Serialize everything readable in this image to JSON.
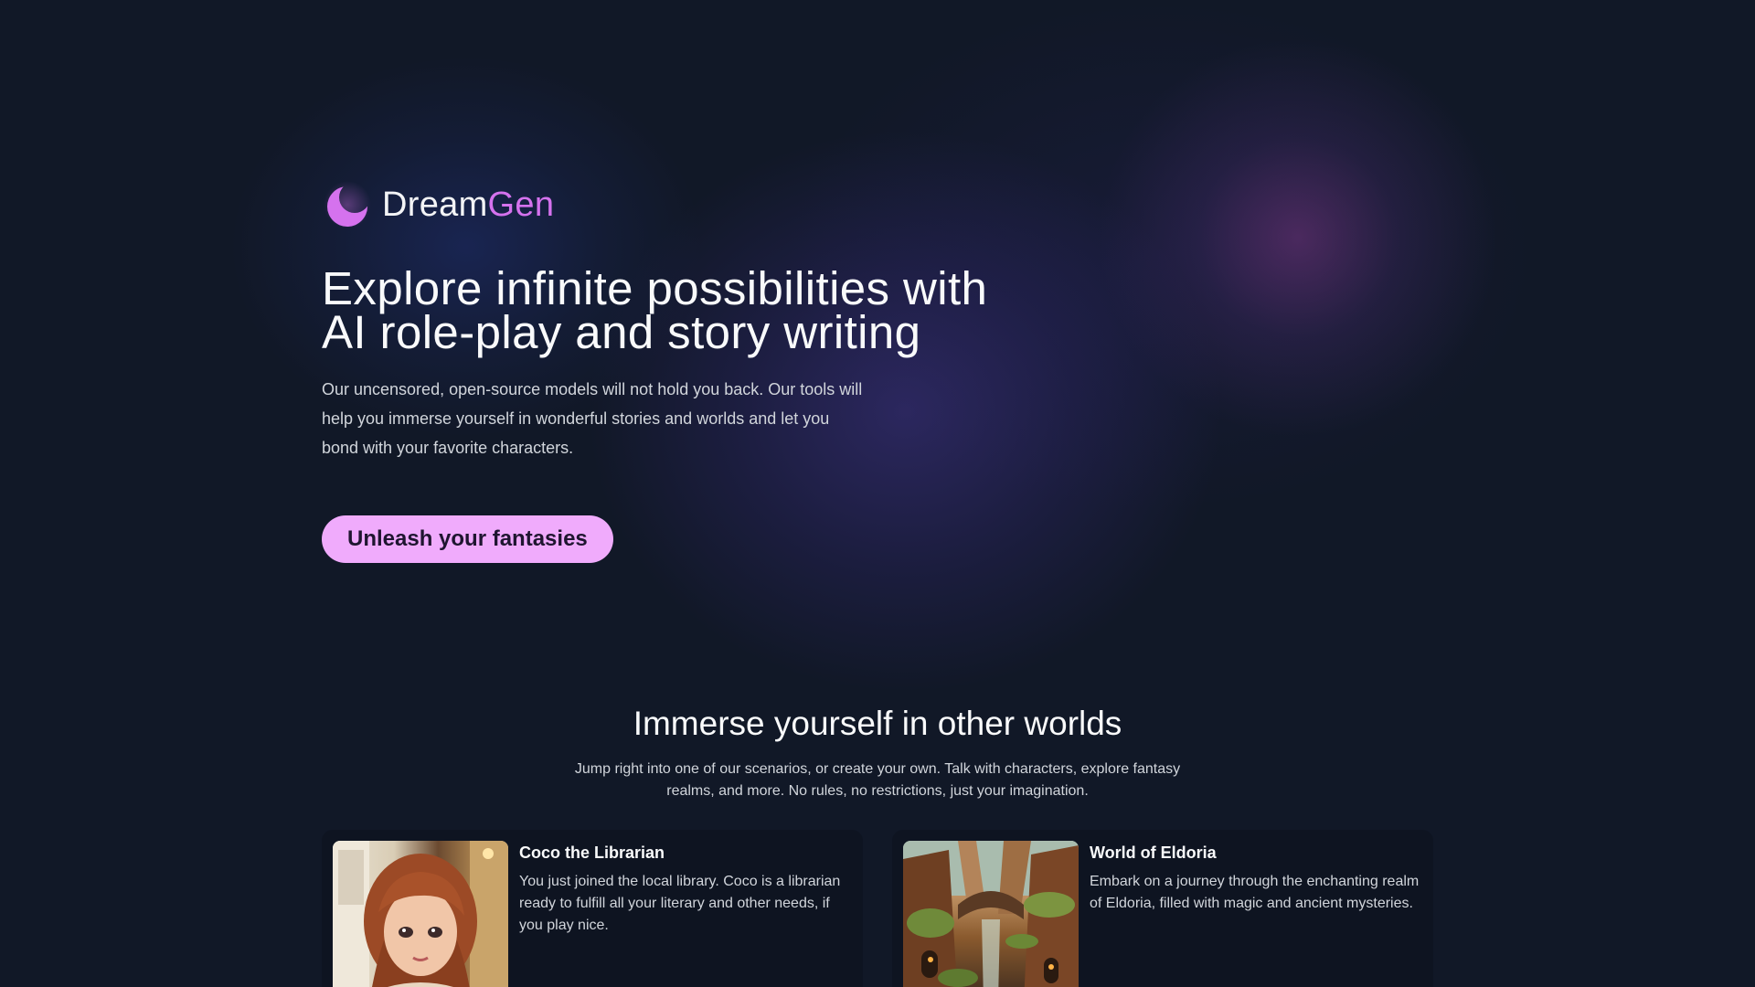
{
  "brand": {
    "name_part1": "Dream",
    "name_part2": "Gen",
    "accent_color": "#d572ee",
    "logo_icon": "crescent-moon-icon"
  },
  "hero": {
    "headline_line1": "Explore infinite possibilities with",
    "headline_line2": "AI role-play and story writing",
    "lede": "Our uncensored, open-source models will not hold you back. Our tools will help you immerse yourself in wonderful stories and worlds and let you bond with your favorite characters.",
    "cta_label": "Unleash your fantasies",
    "cta_color": "#f0abfc"
  },
  "worlds": {
    "title": "Immerse yourself in other worlds",
    "subtitle": "Jump right into one of our scenarios, or create your own. Talk with characters, explore fantasy realms, and more. No rules, no restrictions, just your imagination.",
    "cards": [
      {
        "title": "Coco the Librarian",
        "description": "You just joined the local library. Coco is a librarian ready to fulfill all your literary and other needs, if you play nice.",
        "image": "librarian-portrait"
      },
      {
        "title": "World of Eldoria",
        "description": "Embark on a journey through the enchanting realm of Eldoria, filled with magic and ancient mysteries.",
        "image": "fantasy-canyon-landscape"
      }
    ]
  },
  "colors": {
    "background": "#111827",
    "card_background": "#0e1421"
  }
}
